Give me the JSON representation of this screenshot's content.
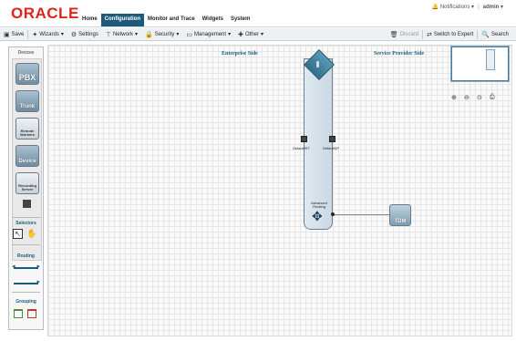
{
  "brand": {
    "logo": "ORACLE"
  },
  "nav": {
    "tabs": [
      "Home",
      "Configuration",
      "Monitor and Trace",
      "Widgets",
      "System"
    ],
    "active": "Configuration"
  },
  "user": {
    "notifications": "Notifications",
    "user": "admin"
  },
  "toolbar": {
    "save": "Save",
    "wizards": "Wizards",
    "settings": "Settings",
    "network": "Network",
    "security": "Security",
    "management": "Management",
    "other": "Other",
    "discard": "Discard",
    "switch_expert": "Switch to Expert",
    "search": "Search"
  },
  "palette": {
    "title": "Devices",
    "items": [
      "PBX",
      "Trunk",
      "Remote Workers",
      "Device",
      "Recording Server"
    ],
    "selectors_title": "Selectors",
    "routing_title": "Routing",
    "grouping_title": "Grouping"
  },
  "canvas": {
    "enterprise_label": "Enterprise Side",
    "provider_label": "Service Provider Side",
    "sbc": {
      "port_left": "DefaultIST",
      "port_right": "DefaultSP",
      "routing_label": "Advanced Routing"
    },
    "tdm_label": "TDM"
  }
}
